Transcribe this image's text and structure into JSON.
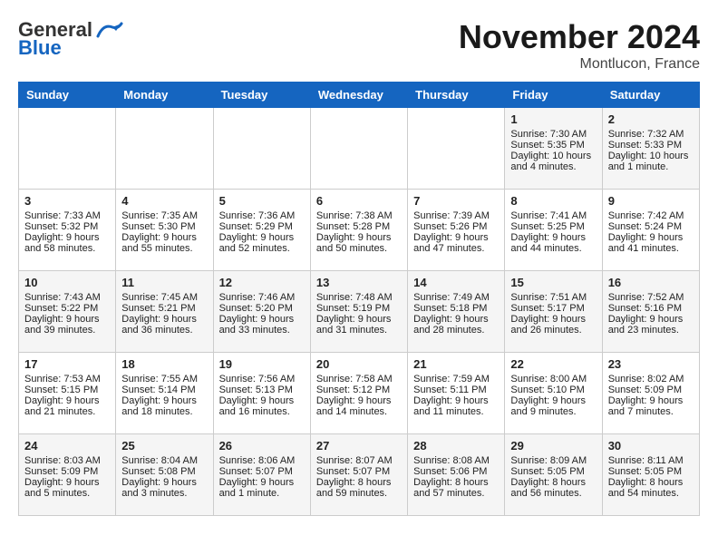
{
  "header": {
    "logo_line1": "General",
    "logo_line2": "Blue",
    "month": "November 2024",
    "location": "Montlucon, France"
  },
  "days_of_week": [
    "Sunday",
    "Monday",
    "Tuesday",
    "Wednesday",
    "Thursday",
    "Friday",
    "Saturday"
  ],
  "weeks": [
    [
      {
        "day": "",
        "info": ""
      },
      {
        "day": "",
        "info": ""
      },
      {
        "day": "",
        "info": ""
      },
      {
        "day": "",
        "info": ""
      },
      {
        "day": "",
        "info": ""
      },
      {
        "day": "1",
        "info": "Sunrise: 7:30 AM\nSunset: 5:35 PM\nDaylight: 10 hours\nand 4 minutes."
      },
      {
        "day": "2",
        "info": "Sunrise: 7:32 AM\nSunset: 5:33 PM\nDaylight: 10 hours\nand 1 minute."
      }
    ],
    [
      {
        "day": "3",
        "info": "Sunrise: 7:33 AM\nSunset: 5:32 PM\nDaylight: 9 hours\nand 58 minutes."
      },
      {
        "day": "4",
        "info": "Sunrise: 7:35 AM\nSunset: 5:30 PM\nDaylight: 9 hours\nand 55 minutes."
      },
      {
        "day": "5",
        "info": "Sunrise: 7:36 AM\nSunset: 5:29 PM\nDaylight: 9 hours\nand 52 minutes."
      },
      {
        "day": "6",
        "info": "Sunrise: 7:38 AM\nSunset: 5:28 PM\nDaylight: 9 hours\nand 50 minutes."
      },
      {
        "day": "7",
        "info": "Sunrise: 7:39 AM\nSunset: 5:26 PM\nDaylight: 9 hours\nand 47 minutes."
      },
      {
        "day": "8",
        "info": "Sunrise: 7:41 AM\nSunset: 5:25 PM\nDaylight: 9 hours\nand 44 minutes."
      },
      {
        "day": "9",
        "info": "Sunrise: 7:42 AM\nSunset: 5:24 PM\nDaylight: 9 hours\nand 41 minutes."
      }
    ],
    [
      {
        "day": "10",
        "info": "Sunrise: 7:43 AM\nSunset: 5:22 PM\nDaylight: 9 hours\nand 39 minutes."
      },
      {
        "day": "11",
        "info": "Sunrise: 7:45 AM\nSunset: 5:21 PM\nDaylight: 9 hours\nand 36 minutes."
      },
      {
        "day": "12",
        "info": "Sunrise: 7:46 AM\nSunset: 5:20 PM\nDaylight: 9 hours\nand 33 minutes."
      },
      {
        "day": "13",
        "info": "Sunrise: 7:48 AM\nSunset: 5:19 PM\nDaylight: 9 hours\nand 31 minutes."
      },
      {
        "day": "14",
        "info": "Sunrise: 7:49 AM\nSunset: 5:18 PM\nDaylight: 9 hours\nand 28 minutes."
      },
      {
        "day": "15",
        "info": "Sunrise: 7:51 AM\nSunset: 5:17 PM\nDaylight: 9 hours\nand 26 minutes."
      },
      {
        "day": "16",
        "info": "Sunrise: 7:52 AM\nSunset: 5:16 PM\nDaylight: 9 hours\nand 23 minutes."
      }
    ],
    [
      {
        "day": "17",
        "info": "Sunrise: 7:53 AM\nSunset: 5:15 PM\nDaylight: 9 hours\nand 21 minutes."
      },
      {
        "day": "18",
        "info": "Sunrise: 7:55 AM\nSunset: 5:14 PM\nDaylight: 9 hours\nand 18 minutes."
      },
      {
        "day": "19",
        "info": "Sunrise: 7:56 AM\nSunset: 5:13 PM\nDaylight: 9 hours\nand 16 minutes."
      },
      {
        "day": "20",
        "info": "Sunrise: 7:58 AM\nSunset: 5:12 PM\nDaylight: 9 hours\nand 14 minutes."
      },
      {
        "day": "21",
        "info": "Sunrise: 7:59 AM\nSunset: 5:11 PM\nDaylight: 9 hours\nand 11 minutes."
      },
      {
        "day": "22",
        "info": "Sunrise: 8:00 AM\nSunset: 5:10 PM\nDaylight: 9 hours\nand 9 minutes."
      },
      {
        "day": "23",
        "info": "Sunrise: 8:02 AM\nSunset: 5:09 PM\nDaylight: 9 hours\nand 7 minutes."
      }
    ],
    [
      {
        "day": "24",
        "info": "Sunrise: 8:03 AM\nSunset: 5:09 PM\nDaylight: 9 hours\nand 5 minutes."
      },
      {
        "day": "25",
        "info": "Sunrise: 8:04 AM\nSunset: 5:08 PM\nDaylight: 9 hours\nand 3 minutes."
      },
      {
        "day": "26",
        "info": "Sunrise: 8:06 AM\nSunset: 5:07 PM\nDaylight: 9 hours\nand 1 minute."
      },
      {
        "day": "27",
        "info": "Sunrise: 8:07 AM\nSunset: 5:07 PM\nDaylight: 8 hours\nand 59 minutes."
      },
      {
        "day": "28",
        "info": "Sunrise: 8:08 AM\nSunset: 5:06 PM\nDaylight: 8 hours\nand 57 minutes."
      },
      {
        "day": "29",
        "info": "Sunrise: 8:09 AM\nSunset: 5:05 PM\nDaylight: 8 hours\nand 56 minutes."
      },
      {
        "day": "30",
        "info": "Sunrise: 8:11 AM\nSunset: 5:05 PM\nDaylight: 8 hours\nand 54 minutes."
      }
    ]
  ]
}
